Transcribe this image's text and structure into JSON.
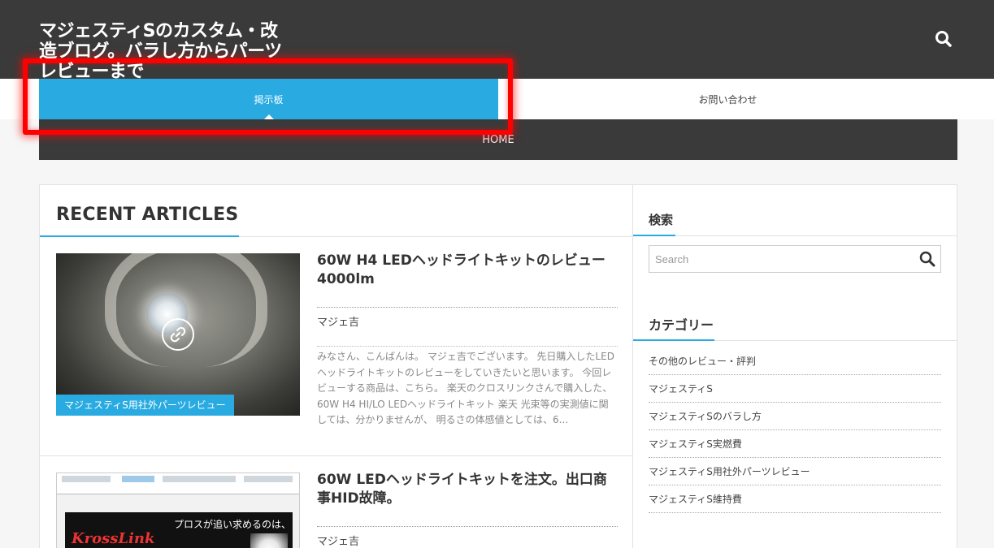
{
  "header": {
    "site_title": "マジェスティSのカスタム・改造ブログ。バラし方からパーツレビューまで",
    "search_icon": "search-icon"
  },
  "nav": {
    "items": [
      {
        "label": "掲示板",
        "active": true
      },
      {
        "label": "お問い合わせ",
        "active": false
      }
    ],
    "sub_items": [
      {
        "label": "HOME"
      }
    ]
  },
  "main": {
    "section_title": "RECENT ARTICLES",
    "articles": [
      {
        "title": "60W H4 LEDヘッドライトキットのレビュー 4000lm",
        "author": "マジェ吉",
        "category": "マジェスティS用社外パーツレビュー",
        "excerpt": "みなさん、こんばんは。 マジェ吉でございます。 先日購入したLEDヘッドライトキットのレビューをしていきたいと思います。 今回レビューする商品は、こちら。 楽天のクロスリンクさんで購入した、60W H4 HI/LO LEDヘッドライトキット 楽天 光束等の実測値に関しては、分かりませんが、 明るさの体感値としては、6...",
        "thumb_icon": "link-icon"
      },
      {
        "title": "60W LEDヘッドライトキットを注文。出口商事HID故障。",
        "author": "マジェ吉",
        "thumb_brand": "KrossLink",
        "thumb_tagline": "プロスが追い求めるのは、"
      }
    ]
  },
  "sidebar": {
    "search_widget": {
      "title": "検索",
      "placeholder": "Search"
    },
    "category_widget": {
      "title": "カテゴリー",
      "items": [
        "その他のレビュー・評判",
        "マジェスティS",
        "マジェスティSのバラし方",
        "マジェスティS実燃費",
        "マジェスティS用社外パーツレビュー",
        "マジェスティS維持費"
      ]
    }
  },
  "colors": {
    "accent": "#29abe2",
    "header_bg": "#3a3a3a",
    "highlight": "#ff0000"
  }
}
